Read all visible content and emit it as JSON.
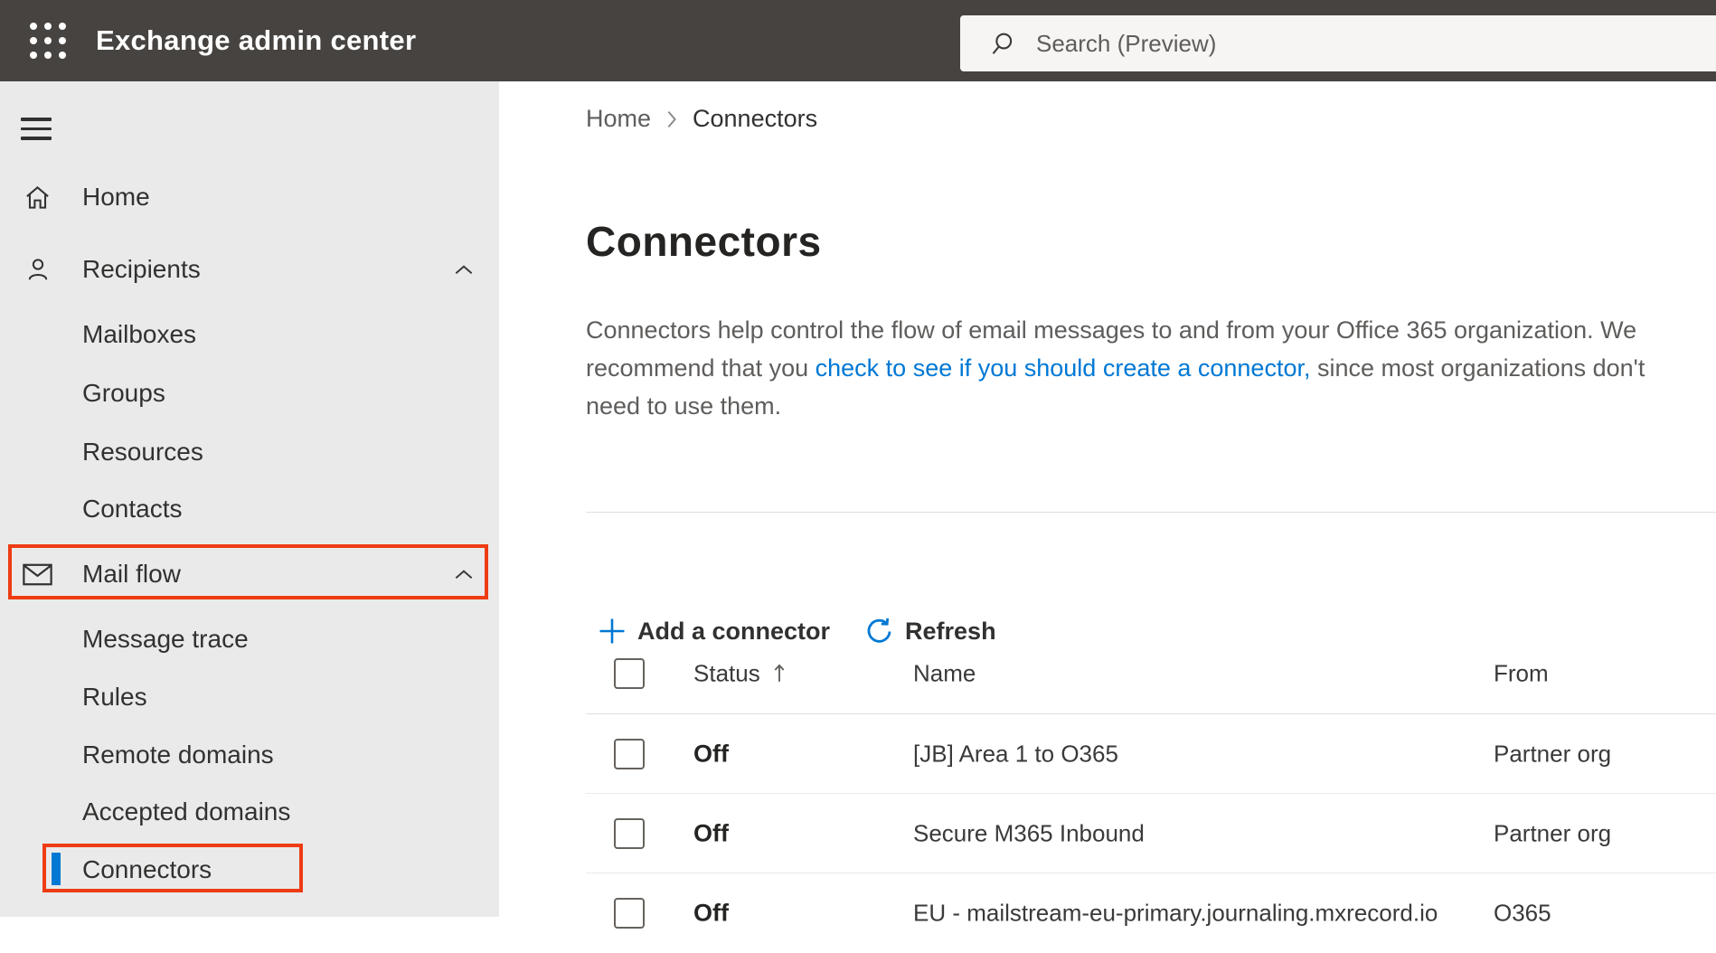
{
  "topbar": {
    "app_title": "Exchange admin center",
    "search_placeholder": "Search (Preview)"
  },
  "breadcrumb": {
    "parent": "Home",
    "current": "Connectors"
  },
  "sidebar": {
    "items": [
      {
        "label": "Home"
      },
      {
        "label": "Recipients",
        "expanded": true
      },
      {
        "label": "Mailboxes"
      },
      {
        "label": "Groups"
      },
      {
        "label": "Resources"
      },
      {
        "label": "Contacts"
      },
      {
        "label": "Mail flow",
        "expanded": true,
        "highlighted": true
      },
      {
        "label": "Message trace"
      },
      {
        "label": "Rules"
      },
      {
        "label": "Remote domains"
      },
      {
        "label": "Accepted domains"
      },
      {
        "label": "Connectors",
        "selected": true,
        "highlighted": true
      }
    ]
  },
  "page": {
    "title": "Connectors",
    "description": {
      "pre": "Connectors help control the flow of email messages to and from your Office 365 organization. We recommend that you ",
      "link": "check to see if you should create a connector,",
      "post": " since most organizations don't need to use them."
    }
  },
  "toolbar": {
    "add_label": "Add a connector",
    "refresh_label": "Refresh"
  },
  "table": {
    "headers": {
      "status": "Status",
      "name": "Name",
      "from": "From"
    },
    "sort": {
      "column": "Status",
      "direction": "ascending"
    },
    "rows": [
      {
        "status": "Off",
        "name": "[JB] Area 1 to O365",
        "from": "Partner org"
      },
      {
        "status": "Off",
        "name": "Secure M365 Inbound",
        "from": "Partner org"
      },
      {
        "status": "Off",
        "name": "EU - mailstream-eu-primary.journaling.mxrecord.io",
        "from": "O365"
      }
    ]
  },
  "icons": {
    "topbar": [
      "waffle-icon",
      "search-icon"
    ],
    "sidebar": [
      "menu-icon",
      "home-icon",
      "person-icon",
      "mail-icon",
      "chevron-up-icon"
    ],
    "content": [
      "chevron-right-icon",
      "add-icon",
      "refresh-icon",
      "sort-ascending-icon",
      "checkbox"
    ]
  },
  "colors": {
    "accent_blue": "#0078d4",
    "annotation_red": "#ee3c13",
    "topbar_bg": "#464340",
    "sidebar_bg": "#eaeaea",
    "link_blue": "#0078d4"
  }
}
